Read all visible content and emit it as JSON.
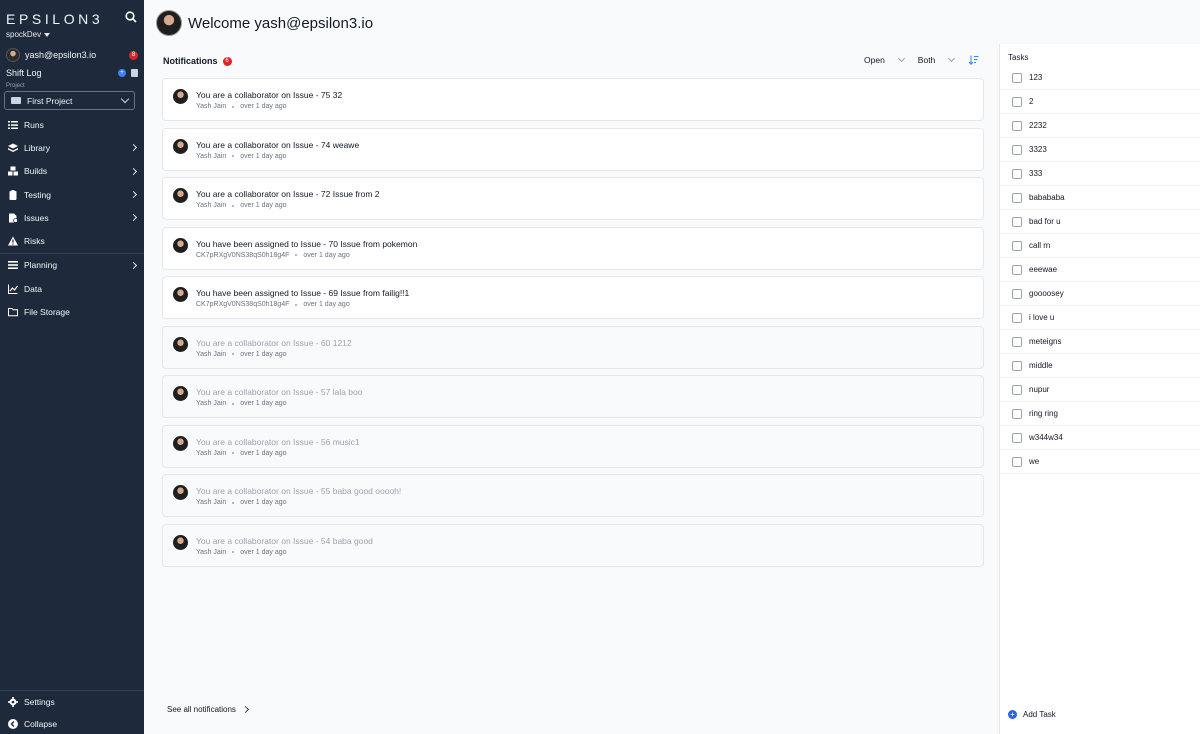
{
  "sidebar": {
    "logo": "EPSILON3",
    "workspace": "spockDev",
    "user": {
      "name": "yash@epsilon3.io",
      "badge": "8"
    },
    "shift_log": {
      "label": "Shift Log"
    },
    "project": {
      "label": "Project",
      "selected": "First Project"
    },
    "nav": [
      {
        "label": "Runs",
        "icon": "runs-icon",
        "arrow": false
      },
      {
        "label": "Library",
        "icon": "library-icon",
        "arrow": true
      },
      {
        "label": "Builds",
        "icon": "builds-icon",
        "arrow": true
      },
      {
        "label": "Testing",
        "icon": "testing-icon",
        "arrow": true
      },
      {
        "label": "Issues",
        "icon": "issues-icon",
        "arrow": true
      },
      {
        "label": "Risks",
        "icon": "risks-icon",
        "arrow": false
      },
      {
        "label": "Planning",
        "icon": "planning-icon",
        "arrow": true
      },
      {
        "label": "Data",
        "icon": "data-icon",
        "arrow": false
      },
      {
        "label": "File Storage",
        "icon": "folder-icon",
        "arrow": false
      }
    ],
    "bottom": [
      {
        "label": "Settings",
        "icon": "gear-icon"
      },
      {
        "label": "Collapse",
        "icon": "collapse-icon"
      }
    ]
  },
  "header": {
    "welcome": "Welcome yash@epsilon3.io"
  },
  "notifications": {
    "title": "Notifications",
    "count": "6",
    "filters": {
      "status": "Open",
      "scope": "Both"
    },
    "items": [
      {
        "text": "You are a collaborator on Issue - 75 32",
        "author": "Yash Jain",
        "time": "over 1 day ago",
        "read": false
      },
      {
        "text": "You are a collaborator on Issue - 74 weawe",
        "author": "Yash Jain",
        "time": "over 1 day ago",
        "read": false
      },
      {
        "text": "You are a collaborator on Issue - 72 Issue from 2",
        "author": "Yash Jain",
        "time": "over 1 day ago",
        "read": false
      },
      {
        "text": "You have been assigned to Issue - 70 Issue from pokemon",
        "author": "CK7pRXgV0NS38qS0h18g4F",
        "time": "over 1 day ago",
        "read": false
      },
      {
        "text": "You have been assigned to Issue - 69 Issue from failig!!1",
        "author": "CK7pRXgV0NS38qS0h18g4F",
        "time": "over 1 day ago",
        "read": false
      },
      {
        "text": "You are a collaborator on Issue - 60 1212",
        "author": "Yash Jain",
        "time": "over 1 day ago",
        "read": true
      },
      {
        "text": "You are a collaborator on Issue - 57 lala boo",
        "author": "Yash Jain",
        "time": "over 1 day ago",
        "read": true
      },
      {
        "text": "You are a collaborator on Issue - 56 music1",
        "author": "Yash Jain",
        "time": "over 1 day ago",
        "read": true
      },
      {
        "text": "You are a collaborator on Issue - 55 baba good ooooh!",
        "author": "Yash Jain",
        "time": "over 1 day ago",
        "read": true
      },
      {
        "text": "You are a collaborator on Issue - 54 baba good",
        "author": "Yash Jain",
        "time": "over 1 day ago",
        "read": true
      }
    ],
    "see_all": "See all notifications"
  },
  "tasks": {
    "title": "Tasks",
    "items": [
      "123",
      "2",
      "2232",
      "3323",
      "333",
      "babababa",
      "bad for u",
      "call rn",
      "eeewae",
      "goooosey",
      "i love u",
      "meteigns",
      "middle",
      "nupur",
      "ring ring",
      "w344w34",
      "we"
    ],
    "add_label": "Add Task"
  },
  "colors": {
    "sidebar_bg": "#1e293b",
    "accent": "#2563eb",
    "badge": "#dc2626"
  }
}
